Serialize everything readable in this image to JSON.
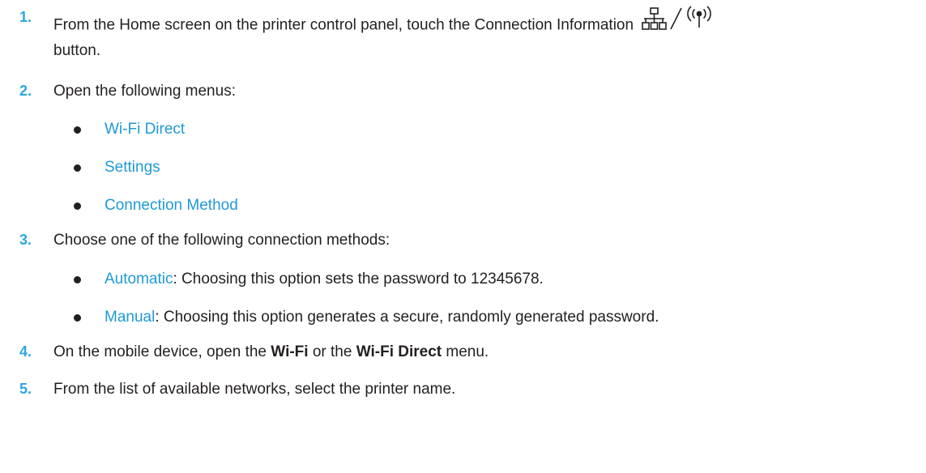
{
  "steps": [
    {
      "number": "1.",
      "line1": "From the Home screen on the printer control panel, touch the Connection Information",
      "line2": "button.",
      "icons": [
        "network-icon",
        "wireless-icon"
      ]
    },
    {
      "number": "2.",
      "text": "Open the following menus:",
      "menus": [
        "Wi-Fi Direct",
        "Settings",
        "Connection Method"
      ]
    },
    {
      "number": "3.",
      "text": "Choose one of the following connection methods:",
      "options": [
        {
          "name": "Automatic",
          "desc": ": Choosing this option sets the password to 12345678."
        },
        {
          "name": "Manual",
          "desc": ": Choosing this option generates a secure, randomly generated password."
        }
      ]
    },
    {
      "number": "4.",
      "pre": "On the mobile device, open the ",
      "bold1": "Wi-Fi",
      "mid": " or the ",
      "bold2": "Wi-Fi Direct",
      "post": " menu."
    },
    {
      "number": "5.",
      "text": "From the list of available networks, select the printer name."
    }
  ],
  "colors": {
    "accent": "#2aa7e0",
    "menu": "#1e9ad6",
    "text": "#231f20"
  }
}
